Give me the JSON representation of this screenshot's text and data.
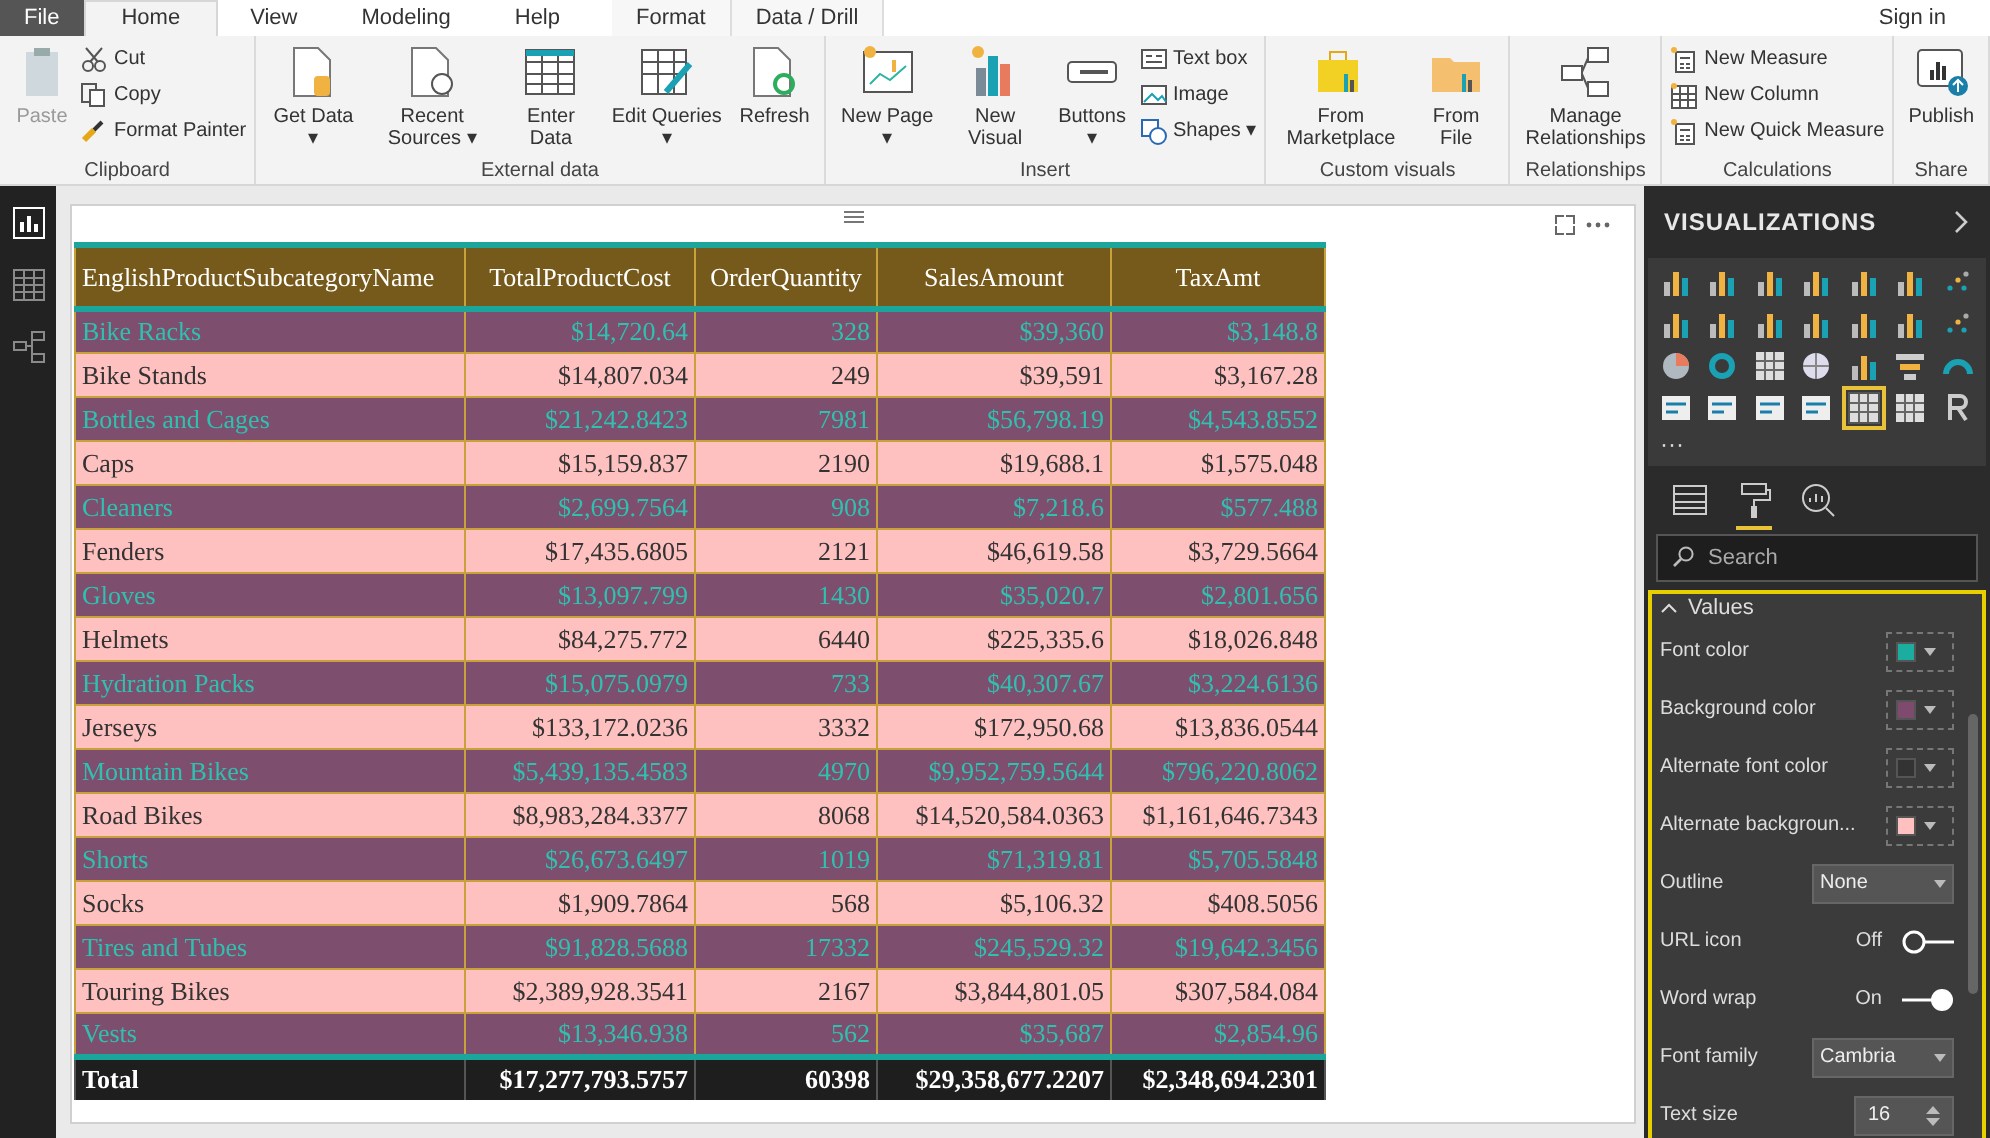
{
  "tabs": [
    {
      "label": "File",
      "kind": "file",
      "selected": false
    },
    {
      "label": "Home",
      "kind": "main",
      "selected": true
    },
    {
      "label": "View",
      "kind": "main",
      "selected": false
    },
    {
      "label": "Modeling",
      "kind": "main",
      "selected": false
    },
    {
      "label": "Help",
      "kind": "main",
      "selected": false
    },
    {
      "label": "Format",
      "kind": "context",
      "selected": false
    },
    {
      "label": "Data / Drill",
      "kind": "context",
      "selected": false
    }
  ],
  "sign_in": "Sign in",
  "ribbon_groups": [
    {
      "label": "Clipboard",
      "items": [
        {
          "kind": "large",
          "label": "Paste",
          "disabled": true
        },
        {
          "kind": "small",
          "label": "Cut",
          "disabled": false
        },
        {
          "kind": "small",
          "label": "Copy",
          "disabled": false
        },
        {
          "kind": "small",
          "label": "Format Painter",
          "disabled": false
        }
      ]
    },
    {
      "label": "External data",
      "items": [
        {
          "kind": "large",
          "label": "Get Data ▾",
          "disabled": false
        },
        {
          "kind": "large",
          "label": "Recent Sources ▾",
          "disabled": false
        },
        {
          "kind": "large",
          "label": "Enter Data",
          "disabled": false
        },
        {
          "kind": "large",
          "label": "Edit Queries ▾",
          "disabled": false
        },
        {
          "kind": "large",
          "label": "Refresh",
          "disabled": false
        }
      ]
    },
    {
      "label": "Insert",
      "items": [
        {
          "kind": "large",
          "label": "New Page ▾",
          "disabled": false
        },
        {
          "kind": "large",
          "label": "New Visual",
          "disabled": false
        },
        {
          "kind": "large",
          "label": "Buttons ▾",
          "disabled": false
        },
        {
          "kind": "small",
          "label": "Text box",
          "disabled": false
        },
        {
          "kind": "small",
          "label": "Image",
          "disabled": false
        },
        {
          "kind": "small",
          "label": "Shapes ▾",
          "disabled": false
        }
      ]
    },
    {
      "label": "Custom visuals",
      "items": [
        {
          "kind": "large",
          "label": "From Marketplace",
          "disabled": false
        },
        {
          "kind": "large",
          "label": "From File",
          "disabled": false
        }
      ]
    },
    {
      "label": "Relationships",
      "items": [
        {
          "kind": "large",
          "label": "Manage Relationships",
          "disabled": false
        }
      ]
    },
    {
      "label": "Calculations",
      "items": [
        {
          "kind": "small",
          "label": "New Measure",
          "disabled": false
        },
        {
          "kind": "small",
          "label": "New Column",
          "disabled": false
        },
        {
          "kind": "small",
          "label": "New Quick Measure",
          "disabled": false
        }
      ]
    },
    {
      "label": "Share",
      "items": [
        {
          "kind": "large",
          "label": "Publish",
          "disabled": false
        }
      ]
    }
  ],
  "left_nav": [
    {
      "kind": "report",
      "selected": true
    },
    {
      "kind": "data",
      "selected": false
    },
    {
      "kind": "relationships",
      "selected": false
    }
  ],
  "table": {
    "columns": [
      "EnglishProductSubcategoryName",
      "TotalProductCost",
      "OrderQuantity",
      "SalesAmount",
      "TaxAmt"
    ],
    "rows": [
      {
        "kind": "primary",
        "cells": [
          "Bike Racks",
          "$14,720.64",
          "328",
          "$39,360",
          "$3,148.8"
        ]
      },
      {
        "kind": "alternate",
        "cells": [
          "Bike Stands",
          "$14,807.034",
          "249",
          "$39,591",
          "$3,167.28"
        ]
      },
      {
        "kind": "primary",
        "cells": [
          "Bottles and Cages",
          "$21,242.8423",
          "7981",
          "$56,798.19",
          "$4,543.8552"
        ]
      },
      {
        "kind": "alternate",
        "cells": [
          "Caps",
          "$15,159.837",
          "2190",
          "$19,688.1",
          "$1,575.048"
        ]
      },
      {
        "kind": "primary",
        "cells": [
          "Cleaners",
          "$2,699.7564",
          "908",
          "$7,218.6",
          "$577.488"
        ]
      },
      {
        "kind": "alternate",
        "cells": [
          "Fenders",
          "$17,435.6805",
          "2121",
          "$46,619.58",
          "$3,729.5664"
        ]
      },
      {
        "kind": "primary",
        "cells": [
          "Gloves",
          "$13,097.799",
          "1430",
          "$35,020.7",
          "$2,801.656"
        ]
      },
      {
        "kind": "alternate",
        "cells": [
          "Helmets",
          "$84,275.772",
          "6440",
          "$225,335.6",
          "$18,026.848"
        ]
      },
      {
        "kind": "primary",
        "cells": [
          "Hydration Packs",
          "$15,075.0979",
          "733",
          "$40,307.67",
          "$3,224.6136"
        ]
      },
      {
        "kind": "alternate",
        "cells": [
          "Jerseys",
          "$133,172.0236",
          "3332",
          "$172,950.68",
          "$13,836.0544"
        ]
      },
      {
        "kind": "primary",
        "cells": [
          "Mountain Bikes",
          "$5,439,135.4583",
          "4970",
          "$9,952,759.5644",
          "$796,220.8062"
        ]
      },
      {
        "kind": "alternate",
        "cells": [
          "Road Bikes",
          "$8,983,284.3377",
          "8068",
          "$14,520,584.0363",
          "$1,161,646.7343"
        ]
      },
      {
        "kind": "primary",
        "cells": [
          "Shorts",
          "$26,673.6497",
          "1019",
          "$71,319.81",
          "$5,705.5848"
        ]
      },
      {
        "kind": "alternate",
        "cells": [
          "Socks",
          "$1,909.7864",
          "568",
          "$5,106.32",
          "$408.5056"
        ]
      },
      {
        "kind": "primary",
        "cells": [
          "Tires and Tubes",
          "$91,828.5688",
          "17332",
          "$245,529.32",
          "$19,642.3456"
        ]
      },
      {
        "kind": "alternate",
        "cells": [
          "Touring Bikes",
          "$2,389,928.3541",
          "2167",
          "$3,844,801.05",
          "$307,584.084"
        ]
      },
      {
        "kind": "primary",
        "cells": [
          "Vests",
          "$13,346.938",
          "562",
          "$35,687",
          "$2,854.96"
        ]
      }
    ],
    "total": [
      "Total",
      "$17,277,793.5757",
      "60398",
      "$29,358,677.2207",
      "$2,348,694.2301"
    ]
  },
  "visualizations": {
    "title": "VISUALIZATIONS",
    "more": "···",
    "visual_icons": [
      {
        "selected": false
      },
      {
        "selected": false
      },
      {
        "selected": false
      },
      {
        "selected": false
      },
      {
        "selected": false
      },
      {
        "selected": false
      },
      {
        "selected": false
      },
      {
        "selected": false
      },
      {
        "selected": false
      },
      {
        "selected": false
      },
      {
        "selected": false
      },
      {
        "selected": false
      },
      {
        "selected": false
      },
      {
        "selected": false
      },
      {
        "selected": false
      },
      {
        "selected": false
      },
      {
        "selected": false
      },
      {
        "selected": false
      },
      {
        "selected": false
      },
      {
        "selected": false
      },
      {
        "selected": false
      },
      {
        "selected": false
      },
      {
        "selected": false
      },
      {
        "selected": false
      },
      {
        "selected": false
      },
      {
        "selected": true
      },
      {
        "selected": false
      },
      {
        "selected": false
      }
    ],
    "pane_tabs": [
      {
        "kind": "fields",
        "selected": false
      },
      {
        "kind": "format",
        "selected": true
      },
      {
        "kind": "analytics",
        "selected": false
      }
    ],
    "search": {
      "placeholder": "Search"
    },
    "section": {
      "label": "Values",
      "expanded": true
    },
    "settings": [
      {
        "kind": "color",
        "label": "Font color",
        "color": "#1aada0"
      },
      {
        "kind": "color",
        "label": "Background color",
        "color": "#7e4b6e"
      },
      {
        "kind": "color",
        "label": "Alternate font color",
        "color": "#333333"
      },
      {
        "kind": "color",
        "label": "Alternate backgroun...",
        "color": "#ffc0c0"
      },
      {
        "kind": "dropdown",
        "label": "Outline",
        "value": "None"
      },
      {
        "kind": "toggle",
        "label": "URL icon",
        "state": "Off",
        "on": false
      },
      {
        "kind": "toggle",
        "label": "Word wrap",
        "state": "On",
        "on": true
      },
      {
        "kind": "dropdown",
        "label": "Font family",
        "value": "Cambria"
      },
      {
        "kind": "stepper",
        "label": "Text size",
        "value": "16"
      }
    ]
  }
}
